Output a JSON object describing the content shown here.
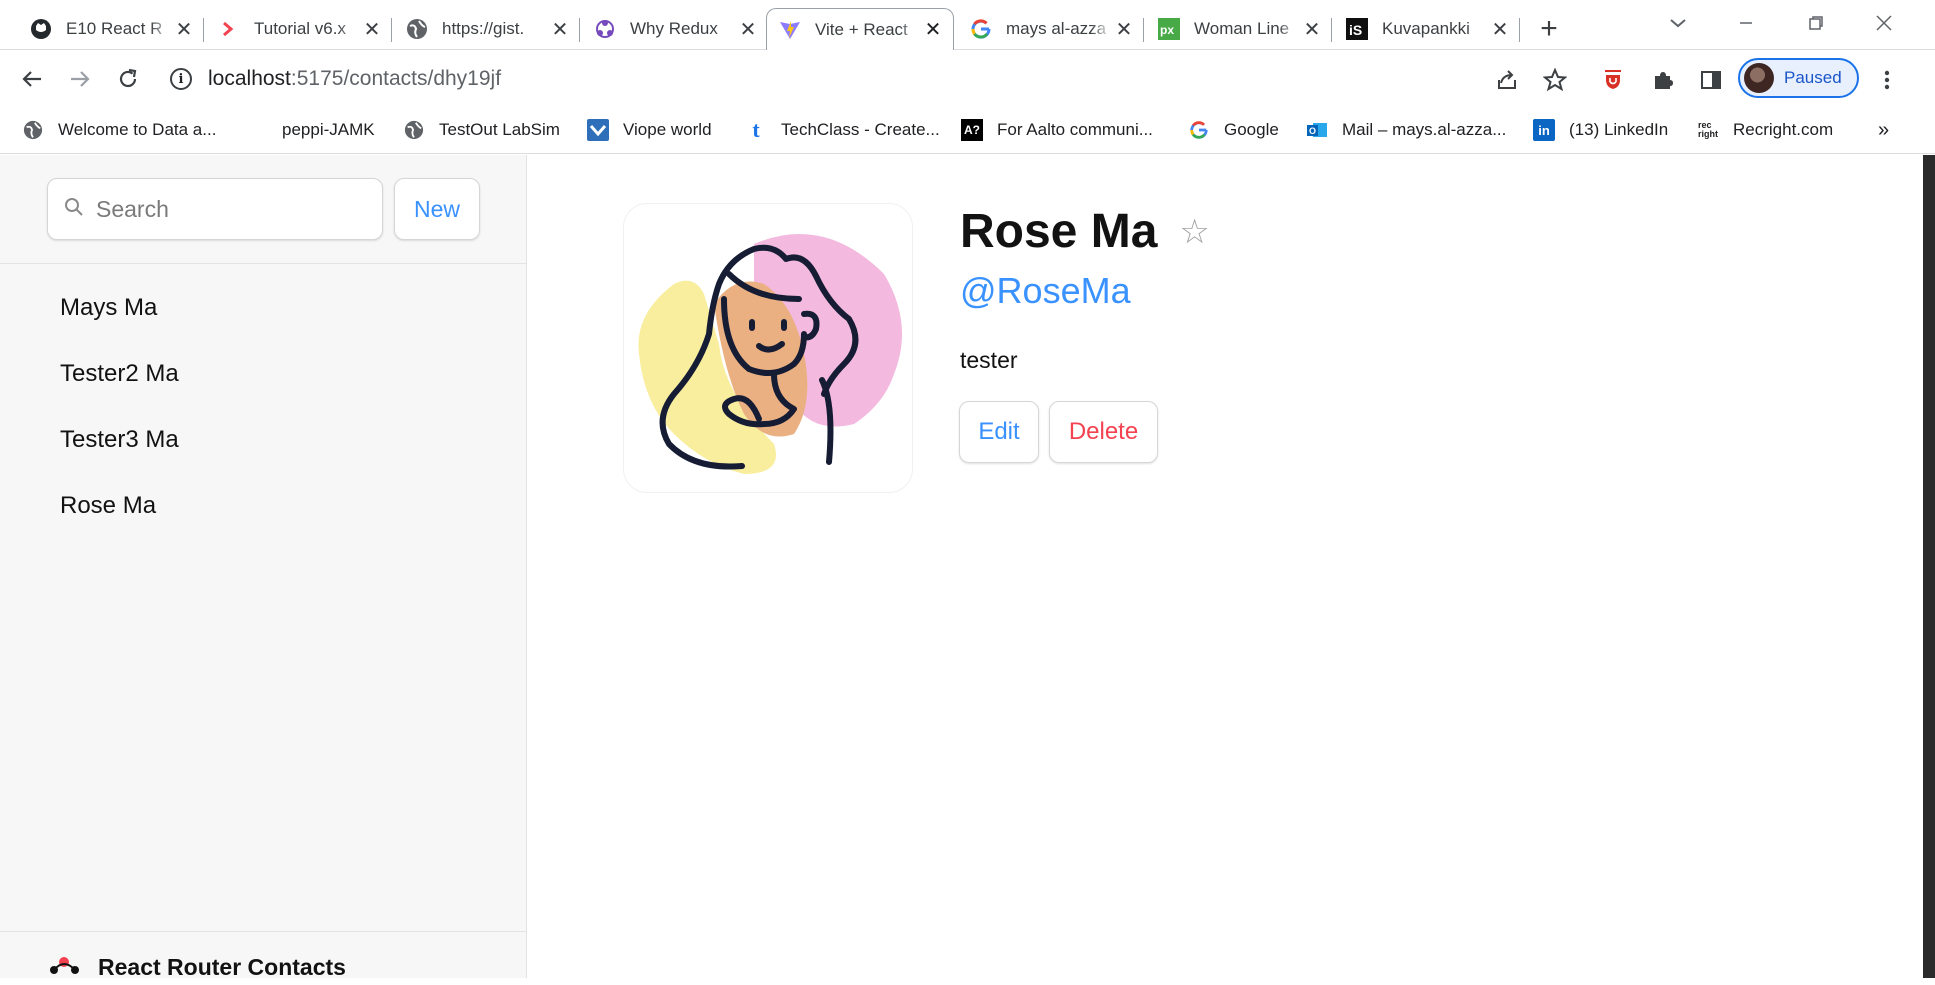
{
  "browser": {
    "tabs": [
      {
        "title": "E10 React R",
        "icon": "github-icon",
        "active": false
      },
      {
        "title": "Tutorial v6.x",
        "icon": "react-router-icon",
        "active": false
      },
      {
        "title": "https://gist.",
        "icon": "globe-icon",
        "active": false
      },
      {
        "title": "Why Redux",
        "icon": "redux-icon",
        "active": false
      },
      {
        "title": "Vite + React",
        "icon": "vite-icon",
        "active": true
      },
      {
        "title": "mays al-azza",
        "icon": "google-icon",
        "active": false
      },
      {
        "title": "Woman Line",
        "icon": "pixabay-icon",
        "active": false
      },
      {
        "title": "Kuvapankki",
        "icon": "istock-icon",
        "active": false
      }
    ],
    "url_host": "localhost",
    "url_path": ":5175/contacts/dhy19jf",
    "profile_label": "Paused",
    "bookmarks": [
      {
        "label": "Welcome to Data a...",
        "icon": "globe-icon"
      },
      {
        "label": "peppi-JAMK",
        "icon": "none"
      },
      {
        "label": "TestOut LabSim",
        "icon": "globe-icon"
      },
      {
        "label": "Viope world",
        "icon": "viope-icon"
      },
      {
        "label": "TechClass - Create...",
        "icon": "techclass-icon"
      },
      {
        "label": "For Aalto communi...",
        "icon": "aalto-icon"
      },
      {
        "label": "Google",
        "icon": "google-icon"
      },
      {
        "label": "Mail – mays.al-azza...",
        "icon": "outlook-icon"
      },
      {
        "label": "(13) LinkedIn",
        "icon": "linkedin-icon"
      },
      {
        "label": "Recright.com",
        "icon": "recright-icon"
      }
    ],
    "bookmarks_overflow": "»"
  },
  "sidebar": {
    "search_placeholder": "Search",
    "new_button": "New",
    "contacts": [
      {
        "name": "Mays Ma"
      },
      {
        "name": "Tester2 Ma"
      },
      {
        "name": "Tester3 Ma"
      },
      {
        "name": "Rose Ma"
      }
    ],
    "footer_brand": "React Router Contacts"
  },
  "contact": {
    "name": "Rose Ma",
    "favorite": false,
    "handle": "@RoseMa",
    "notes": "tester",
    "edit_label": "Edit",
    "delete_label": "Delete"
  },
  "colors": {
    "accent": "#3992ff",
    "danger": "#f44250",
    "sidebar_bg": "#f7f7f7"
  }
}
